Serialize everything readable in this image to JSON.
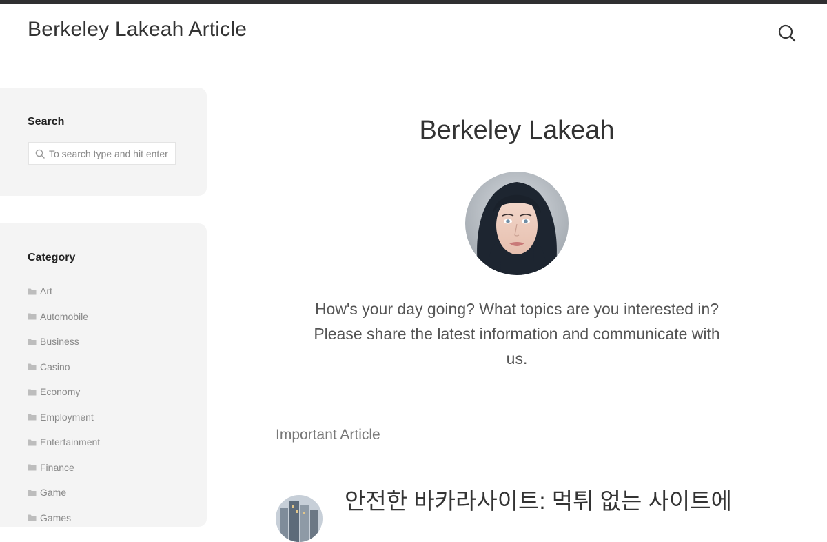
{
  "header": {
    "site_title": "Berkeley Lakeah Article",
    "search_icon": "search-icon"
  },
  "sidebar": {
    "search_widget": {
      "title": "Search",
      "placeholder": "To search type and hit enter",
      "icon": "search-icon"
    },
    "category_widget": {
      "title": "Category",
      "items": [
        {
          "label": "Art"
        },
        {
          "label": "Automobile"
        },
        {
          "label": "Business"
        },
        {
          "label": "Casino"
        },
        {
          "label": "Economy"
        },
        {
          "label": "Employment"
        },
        {
          "label": "Entertainment"
        },
        {
          "label": "Finance"
        },
        {
          "label": "Game"
        },
        {
          "label": "Games"
        }
      ],
      "item_icon": "folder-icon"
    }
  },
  "main": {
    "author_name": "Berkeley Lakeah",
    "bio": "How's your day going? What topics are you interested in? Please share the latest information and communicate with us.",
    "section_heading": "Important Article",
    "articles": [
      {
        "title": "안전한 바카라사이트: 먹튀 없는 사이트에"
      }
    ]
  },
  "colors": {
    "topbar": "#2f2f31",
    "widget_bg": "#f4f4f4",
    "text_dark": "#333333",
    "text_muted": "#8a8a8a"
  }
}
